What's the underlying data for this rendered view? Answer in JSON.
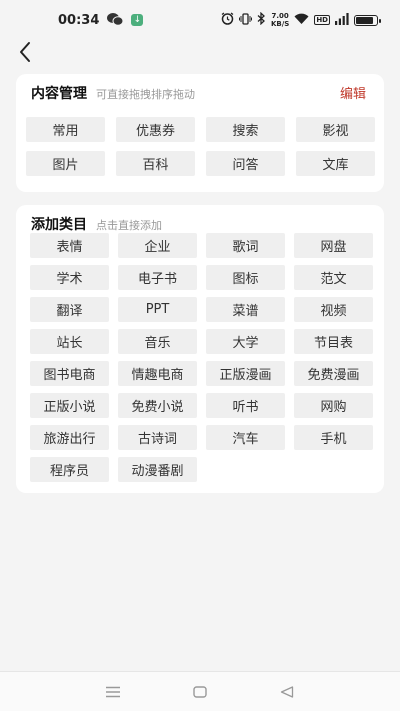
{
  "status_bar": {
    "time": "00:34",
    "net_speed_value": "7.00",
    "net_speed_unit": "KB/S",
    "hd_label": "HD",
    "battery_level": 0.85
  },
  "content_manage": {
    "title": "内容管理",
    "hint": "可直接拖拽排序拖动",
    "edit_label": "编辑",
    "items": [
      "常用",
      "优惠券",
      "搜索",
      "影视",
      "图片",
      "百科",
      "问答",
      "文库"
    ]
  },
  "add_category": {
    "title": "添加类目",
    "hint": "点击直接添加",
    "items": [
      "表情",
      "企业",
      "歌词",
      "网盘",
      "学术",
      "电子书",
      "图标",
      "范文",
      "翻译",
      "PPT",
      "菜谱",
      "视频",
      "站长",
      "音乐",
      "大学",
      "节目表",
      "图书电商",
      "情趣电商",
      "正版漫画",
      "免费漫画",
      "正版小说",
      "免费小说",
      "听书",
      "网购",
      "旅游出行",
      "古诗词",
      "汽车",
      "手机",
      "程序员",
      "动漫番剧"
    ]
  }
}
